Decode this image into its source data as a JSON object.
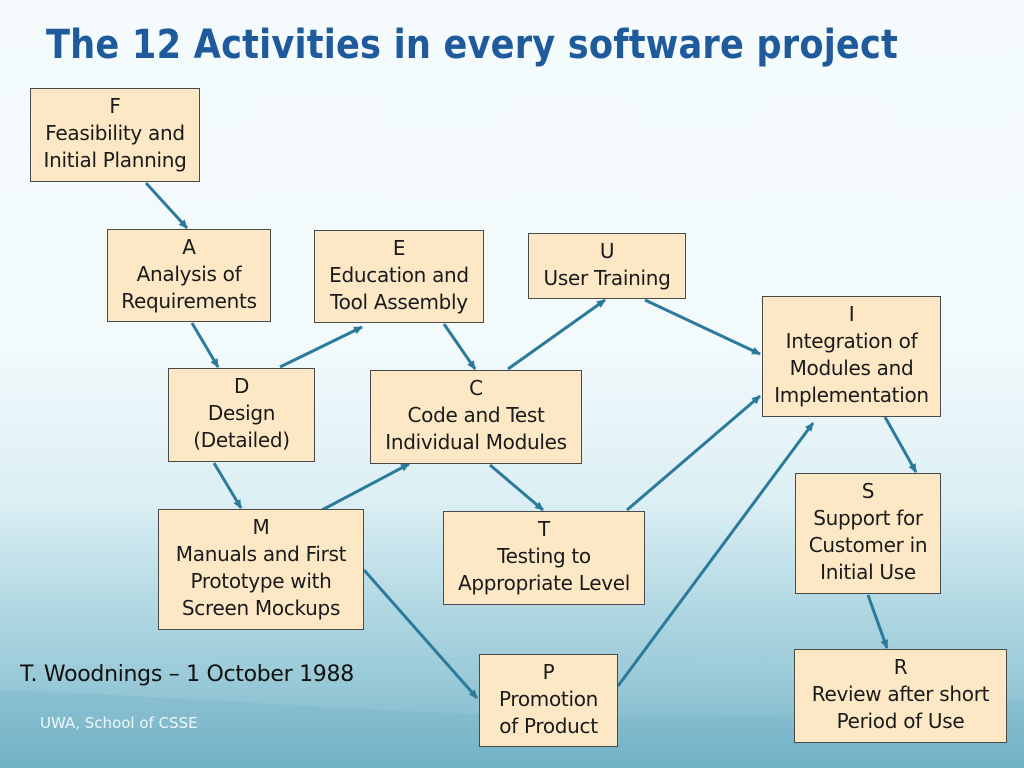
{
  "slide": {
    "title": "The 12 Activities in every software project",
    "author_line": "T. Woodnings – 1 October 1988",
    "footer": "UWA, School of CSSE"
  },
  "colors": {
    "title": "#1f5a9c",
    "box_fill": "#fde8c6",
    "box_border": "#4a4a4a",
    "arrow": "#2b7a9c"
  },
  "activities": {
    "F": {
      "code": "F",
      "lines": [
        "Feasibility and",
        "Initial Planning"
      ]
    },
    "A": {
      "code": "A",
      "lines": [
        "Analysis of",
        "Requirements"
      ]
    },
    "E": {
      "code": "E",
      "lines": [
        "Education and",
        "Tool Assembly"
      ]
    },
    "U": {
      "code": "U",
      "lines": [
        "User Training"
      ]
    },
    "I": {
      "code": "I",
      "lines": [
        "Integration of",
        "Modules and",
        "Implementation"
      ]
    },
    "D": {
      "code": "D",
      "lines": [
        "Design",
        "(Detailed)"
      ]
    },
    "C": {
      "code": "C",
      "lines": [
        "Code and Test",
        "Individual Modules"
      ]
    },
    "M": {
      "code": "M",
      "lines": [
        "Manuals and First",
        "Prototype with",
        "Screen Mockups"
      ]
    },
    "T": {
      "code": "T",
      "lines": [
        "Testing to",
        "Appropriate Level"
      ]
    },
    "S": {
      "code": "S",
      "lines": [
        "Support for",
        "Customer in",
        "Initial Use"
      ]
    },
    "P": {
      "code": "P",
      "lines": [
        "Promotion",
        "of Product"
      ]
    },
    "R": {
      "code": "R",
      "lines": [
        "Review after short",
        "Period of Use"
      ]
    }
  },
  "edges": [
    {
      "from": "F",
      "to": "A"
    },
    {
      "from": "A",
      "to": "D"
    },
    {
      "from": "D",
      "to": "E"
    },
    {
      "from": "E",
      "to": "C"
    },
    {
      "from": "C",
      "to": "U"
    },
    {
      "from": "U",
      "to": "I"
    },
    {
      "from": "D",
      "to": "M"
    },
    {
      "from": "M",
      "to": "C"
    },
    {
      "from": "C",
      "to": "T"
    },
    {
      "from": "T",
      "to": "I"
    },
    {
      "from": "M",
      "to": "P"
    },
    {
      "from": "P",
      "to": "I"
    },
    {
      "from": "I",
      "to": "S"
    },
    {
      "from": "S",
      "to": "R"
    }
  ]
}
